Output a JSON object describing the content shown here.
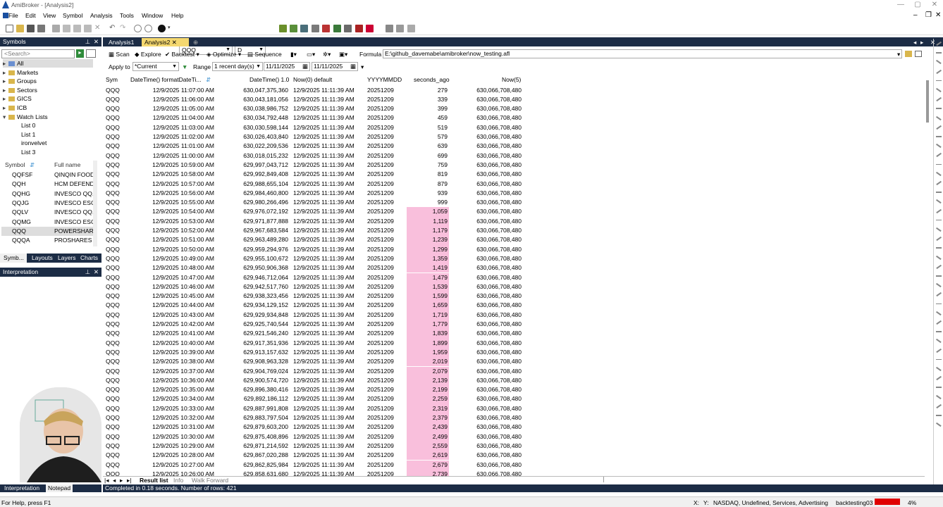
{
  "window": {
    "title": "AmiBroker - [Analysis2]"
  },
  "menu": {
    "items": [
      "File",
      "Edit",
      "View",
      "Symbol",
      "Analysis",
      "Tools",
      "Window",
      "Help"
    ]
  },
  "toolbar": {
    "symbol": "QQQ",
    "interval": "D"
  },
  "symbols_panel": {
    "title": "Symbols",
    "search_placeholder": "<Search>",
    "tree": [
      {
        "label": "All",
        "indent": 0,
        "folder": false,
        "selected": true
      },
      {
        "label": "Markets",
        "indent": 0,
        "folder": true
      },
      {
        "label": "Groups",
        "indent": 0,
        "folder": true
      },
      {
        "label": "Sectors",
        "indent": 0,
        "folder": true
      },
      {
        "label": "GICS",
        "indent": 0,
        "folder": true
      },
      {
        "label": "ICB",
        "indent": 0,
        "folder": true
      },
      {
        "label": "Watch Lists",
        "indent": 0,
        "folder": true,
        "expanded": true
      },
      {
        "label": "List 0",
        "indent": 1,
        "folder": false
      },
      {
        "label": "List 1",
        "indent": 1,
        "folder": false
      },
      {
        "label": "ironvelvet",
        "indent": 1,
        "folder": false
      },
      {
        "label": "List 3",
        "indent": 1,
        "folder": false
      }
    ],
    "columns": [
      "Symbol",
      "Full name"
    ],
    "rows": [
      {
        "symbol": "QQFSF",
        "name": "QINQIN FOOD"
      },
      {
        "symbol": "QQH",
        "name": "HCM DEFEND"
      },
      {
        "symbol": "QQHG",
        "name": "INVESCO QQ..."
      },
      {
        "symbol": "QQJG",
        "name": "INVESCO ESG"
      },
      {
        "symbol": "QQLV",
        "name": "INVESCO QQ..."
      },
      {
        "symbol": "QQMG",
        "name": "INVESCO ESG"
      },
      {
        "symbol": "QQQ",
        "name": "POWERSHARE"
      },
      {
        "symbol": "QQQA",
        "name": "PROSHARES N"
      }
    ],
    "tabs": [
      "Symb...",
      "Layouts",
      "Layers",
      "Charts"
    ]
  },
  "interpretation": {
    "title": "Interpretation"
  },
  "left_bottom_tabs": [
    "Interpretation",
    "Notepad"
  ],
  "doc_tabs": [
    "Analysis1",
    "Analysis2"
  ],
  "analysis_toolbar": {
    "scan": "Scan",
    "explore": "Explore",
    "backtest": "Backtest",
    "optimize": "Optimize",
    "sequence": "Sequence",
    "formula_label": "Formula",
    "formula_path": "E:\\github_davemabe\\amibroker\\now_testing.afl"
  },
  "range_bar": {
    "apply_to_label": "Apply to",
    "apply_to_value": "*Current",
    "range_label": "Range",
    "range_value": "1 recent day(s)",
    "from_date": "11/11/2025",
    "to_date": "11/11/2025"
  },
  "results": {
    "columns": [
      "Sym",
      "DateTime() formatDateTi...",
      "DateTime() 1.0",
      "Now(0) default",
      "YYYYMMDD",
      "seconds_ago",
      "Now(5)"
    ],
    "sym": "QQQ",
    "now_default": "12/9/2025 11:11:39 AM",
    "yyyymmdd": "20251209",
    "now5": "630,066,708,480",
    "rows": [
      {
        "time": "12/9/2025 11:07:00 AM",
        "dt": "630,047,375,360",
        "sec": "279"
      },
      {
        "time": "12/9/2025 11:06:00 AM",
        "dt": "630,043,181,056",
        "sec": "339"
      },
      {
        "time": "12/9/2025 11:05:00 AM",
        "dt": "630,038,986,752",
        "sec": "399"
      },
      {
        "time": "12/9/2025 11:04:00 AM",
        "dt": "630,034,792,448",
        "sec": "459"
      },
      {
        "time": "12/9/2025 11:03:00 AM",
        "dt": "630,030,598,144",
        "sec": "519"
      },
      {
        "time": "12/9/2025 11:02:00 AM",
        "dt": "630,026,403,840",
        "sec": "579"
      },
      {
        "time": "12/9/2025 11:01:00 AM",
        "dt": "630,022,209,536",
        "sec": "639"
      },
      {
        "time": "12/9/2025 11:00:00 AM",
        "dt": "630,018,015,232",
        "sec": "699"
      },
      {
        "time": "12/9/2025 10:59:00 AM",
        "dt": "629,997,043,712",
        "sec": "759"
      },
      {
        "time": "12/9/2025 10:58:00 AM",
        "dt": "629,992,849,408",
        "sec": "819"
      },
      {
        "time": "12/9/2025 10:57:00 AM",
        "dt": "629,988,655,104",
        "sec": "879"
      },
      {
        "time": "12/9/2025 10:56:00 AM",
        "dt": "629,984,460,800",
        "sec": "939"
      },
      {
        "time": "12/9/2025 10:55:00 AM",
        "dt": "629,980,266,496",
        "sec": "999"
      },
      {
        "time": "12/9/2025 10:54:00 AM",
        "dt": "629,976,072,192",
        "sec": "1,059",
        "hl": true
      },
      {
        "time": "12/9/2025 10:53:00 AM",
        "dt": "629,971,877,888",
        "sec": "1,119",
        "hl": true
      },
      {
        "time": "12/9/2025 10:52:00 AM",
        "dt": "629,967,683,584",
        "sec": "1,179",
        "hl": true
      },
      {
        "time": "12/9/2025 10:51:00 AM",
        "dt": "629,963,489,280",
        "sec": "1,239",
        "hl": true
      },
      {
        "time": "12/9/2025 10:50:00 AM",
        "dt": "629,959,294,976",
        "sec": "1,299",
        "hl": true
      },
      {
        "time": "12/9/2025 10:49:00 AM",
        "dt": "629,955,100,672",
        "sec": "1,359",
        "hl": true
      },
      {
        "time": "12/9/2025 10:48:00 AM",
        "dt": "629,950,906,368",
        "sec": "1,419",
        "hl": true
      },
      {
        "time": "12/9/2025 10:47:00 AM",
        "dt": "629,946,712,064",
        "sec": "1,479",
        "hl": true
      },
      {
        "time": "12/9/2025 10:46:00 AM",
        "dt": "629,942,517,760",
        "sec": "1,539",
        "hl": true
      },
      {
        "time": "12/9/2025 10:45:00 AM",
        "dt": "629,938,323,456",
        "sec": "1,599",
        "hl": true
      },
      {
        "time": "12/9/2025 10:44:00 AM",
        "dt": "629,934,129,152",
        "sec": "1,659",
        "hl": true
      },
      {
        "time": "12/9/2025 10:43:00 AM",
        "dt": "629,929,934,848",
        "sec": "1,719",
        "hl": true
      },
      {
        "time": "12/9/2025 10:42:00 AM",
        "dt": "629,925,740,544",
        "sec": "1,779",
        "hl": true
      },
      {
        "time": "12/9/2025 10:41:00 AM",
        "dt": "629,921,546,240",
        "sec": "1,839",
        "hl": true
      },
      {
        "time": "12/9/2025 10:40:00 AM",
        "dt": "629,917,351,936",
        "sec": "1,899",
        "hl": true
      },
      {
        "time": "12/9/2025 10:39:00 AM",
        "dt": "629,913,157,632",
        "sec": "1,959",
        "hl": true
      },
      {
        "time": "12/9/2025 10:38:00 AM",
        "dt": "629,908,963,328",
        "sec": "2,019",
        "hl": true
      },
      {
        "time": "12/9/2025 10:37:00 AM",
        "dt": "629,904,769,024",
        "sec": "2,079",
        "hl": true
      },
      {
        "time": "12/9/2025 10:36:00 AM",
        "dt": "629,900,574,720",
        "sec": "2,139",
        "hl": true
      },
      {
        "time": "12/9/2025 10:35:00 AM",
        "dt": "629,896,380,416",
        "sec": "2,199",
        "hl": true
      },
      {
        "time": "12/9/2025 10:34:00 AM",
        "dt": "629,892,186,112",
        "sec": "2,259",
        "hl": true
      },
      {
        "time": "12/9/2025 10:33:00 AM",
        "dt": "629,887,991,808",
        "sec": "2,319",
        "hl": true
      },
      {
        "time": "12/9/2025 10:32:00 AM",
        "dt": "629,883,797,504",
        "sec": "2,379",
        "hl": true
      },
      {
        "time": "12/9/2025 10:31:00 AM",
        "dt": "629,879,603,200",
        "sec": "2,439",
        "hl": true
      },
      {
        "time": "12/9/2025 10:30:00 AM",
        "dt": "629,875,408,896",
        "sec": "2,499",
        "hl": true
      },
      {
        "time": "12/9/2025 10:29:00 AM",
        "dt": "629,871,214,592",
        "sec": "2,559",
        "hl": true
      },
      {
        "time": "12/9/2025 10:28:00 AM",
        "dt": "629,867,020,288",
        "sec": "2,619",
        "hl": true
      },
      {
        "time": "12/9/2025 10:27:00 AM",
        "dt": "629,862,825,984",
        "sec": "2,679",
        "hl": true
      },
      {
        "time": "12/9/2025 10:26:00 AM",
        "dt": "629,858,631,680",
        "sec": "2,739",
        "hl": true
      }
    ]
  },
  "result_tabs": [
    "Result list",
    "Info",
    "Walk Forward"
  ],
  "completed": "Completed in 0.18 seconds. Number of rows: 421",
  "status": {
    "help": "For Help, press F1",
    "coords": "X:",
    "yval": "Y:",
    "info": "NASDAQ, Undefined, Services, Advertising",
    "db": "backtesting03",
    "pct": "4%"
  },
  "colors": {
    "panel_header": "#1c2c45",
    "highlight": "#f9bfdc",
    "active_tab": "#f5d870",
    "status_red": "#e00000"
  }
}
